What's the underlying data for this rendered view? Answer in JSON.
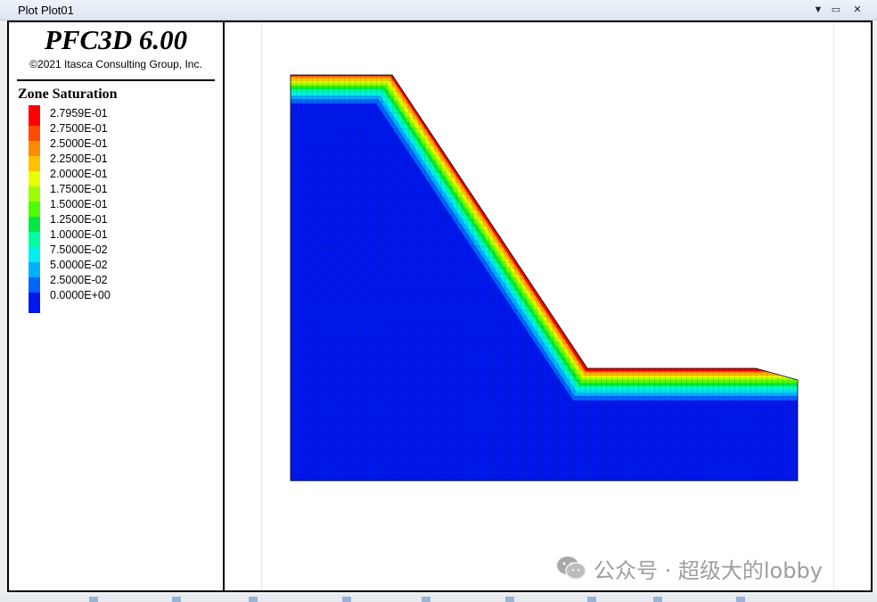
{
  "window": {
    "title": "Plot Plot01",
    "menu_icon": "chevron-down-icon",
    "restore_icon": "restore-icon",
    "close_icon": "close-icon"
  },
  "legend": {
    "app_title": "PFC3D 6.00",
    "copyright": "©2021 Itasca Consulting Group, Inc.",
    "contour_title": "Zone Saturation",
    "entries": [
      {
        "label": "2.7959E-01",
        "color": "#ff0000"
      },
      {
        "label": "2.7500E-01",
        "color": "#ff4a00"
      },
      {
        "label": "2.5000E-01",
        "color": "#ff8c00"
      },
      {
        "label": "2.2500E-01",
        "color": "#ffc000"
      },
      {
        "label": "2.0000E-01",
        "color": "#e8ff00"
      },
      {
        "label": "1.7500E-01",
        "color": "#9cff00"
      },
      {
        "label": "1.5000E-01",
        "color": "#4cff00"
      },
      {
        "label": "1.2500E-01",
        "color": "#00e844"
      },
      {
        "label": "1.0000E-01",
        "color": "#00ffa0"
      },
      {
        "label": "7.5000E-02",
        "color": "#00eeee"
      },
      {
        "label": "5.0000E-02",
        "color": "#00b0ff"
      },
      {
        "label": "2.5000E-02",
        "color": "#0064ff"
      },
      {
        "label": "0.0000E+00",
        "color": "#0018ee"
      }
    ]
  },
  "watermark": {
    "text": "公众号 · 超级大的lobby",
    "icon": "wechat-icon"
  },
  "colors": {
    "frame": "#000000",
    "mesh_line": "#000000"
  }
}
